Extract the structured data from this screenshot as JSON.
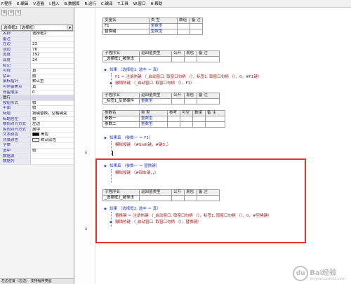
{
  "menu": [
    "F.程序",
    "E.编辑",
    "V.查看",
    "I.插入",
    "B.数据库",
    "R.运行",
    "C.编译",
    "T.工具",
    "W.窗口",
    "H.帮助"
  ],
  "props": {
    "selected": "选择框2（选择框）",
    "rows": [
      {
        "name": "名称",
        "value": "选择框2"
      },
      {
        "name": "备注",
        "value": ""
      },
      {
        "name": "左边",
        "value": "23"
      },
      {
        "name": "顶边",
        "value": "76"
      },
      {
        "name": "宽度",
        "value": "192"
      },
      {
        "name": "高度",
        "value": "24"
      },
      {
        "name": "标记",
        "value": ""
      },
      {
        "name": "可视",
        "value": "真"
      },
      {
        "name": "禁止",
        "value": "假"
      },
      {
        "name": "鼠标指针",
        "value": "默认型"
      },
      {
        "name": "可停留焦点",
        "value": "真"
      },
      {
        "name": "停留顺序",
        "value": "0"
      },
      {
        "name": "图片",
        "value": "",
        "section": true
      },
      {
        "name": "按钮形式",
        "value": "假"
      },
      {
        "name": "平面",
        "value": "假"
      },
      {
        "name": "标题",
        "value": "按键替换，空格键变"
      },
      {
        "name": "标题居左",
        "value": "假"
      },
      {
        "name": "横向对齐方式",
        "value": "左边"
      },
      {
        "name": "纵向对齐方式",
        "value": "居中"
      },
      {
        "name": "文本颜色",
        "value": "黑色",
        "swatch": "#000000"
      },
      {
        "name": "背景颜色",
        "value": "默认底色",
        "swatch": "#ececec"
      },
      {
        "name": "字体",
        "value": ""
      },
      {
        "name": "选中",
        "value": "假"
      },
      {
        "name": "数据源",
        "value": ""
      },
      {
        "name": "数据列",
        "value": ""
      }
    ],
    "status": "左边位置（左边） 支持程序类型"
  },
  "var_table": {
    "headers": [
      "变量名",
      "类 型",
      "数组",
      "备 注"
    ],
    "rows": [
      [
        "F1",
        "整数型",
        "",
        ""
      ],
      [
        "替换键",
        "整数型",
        "",
        ""
      ]
    ]
  },
  "sub1": {
    "headers": [
      "子程序名",
      "返回值类型",
      "公开",
      "易包",
      "备 注"
    ],
    "name": "_选择框1_被单击",
    "lines": [
      "如果 （选择框1. 选中 ＝ 真）",
      "F1 ＝ 注册热键 （_启动窗口. 取窗口句柄 （），标签1. 取窗口句柄 （），0，#F1键）",
      "撤销热键 （_启动窗口. 取窗口句柄 （），F1）"
    ]
  },
  "sub2": {
    "headers": [
      "子程序名",
      "返回值类型",
      "公开",
      "易包",
      "备 注"
    ],
    "name": "_标签1_反馈事件",
    "ret_type": "整数型",
    "param_headers": [
      "参数名",
      "类 型",
      "参考",
      "可空",
      "数组",
      "备 注"
    ],
    "params": [
      [
        "参数一",
        "整数型"
      ],
      [
        "参数二",
        "整数型"
      ]
    ],
    "lines": [
      "如果真 （参数一 ＝ F1）",
      "模拟按键 （#Shift键，#键3，）",
      "如果真 （参数一 ＝ 替换键）",
      "模拟按键 （#回车键，，）"
    ]
  },
  "sub3": {
    "headers": [
      "子程序名",
      "返回值类型",
      "公开",
      "易包",
      "备 注"
    ],
    "name": "_选择框2_被单击",
    "lines": [
      "如果 （选择框2. 选中 ＝ 真）",
      "替换键 ＝ 注册热键 （_启动窗口. 取窗口句柄 （），标签1. 取窗口句柄 （），0，#空格键）",
      "撤销热键 （_启动窗口. 取窗口句柄 （），替换键）"
    ]
  },
  "watermark": {
    "main": "Bai经验",
    "sub": "jingyan.baidu.com"
  }
}
